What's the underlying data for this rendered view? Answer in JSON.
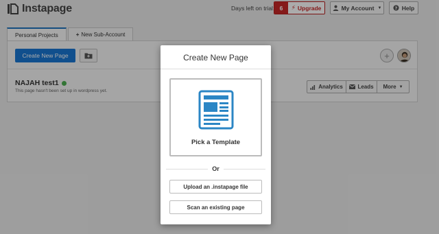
{
  "app": {
    "name": "Instapage"
  },
  "topbar": {
    "trial_label": "Days left on trial:",
    "trial_days": "6",
    "upgrade_label": "Upgrade",
    "account_label": "My Account",
    "help_label": "Help"
  },
  "tabs": [
    {
      "label": "Personal Projects",
      "active": true
    },
    {
      "label": "New Sub-Account",
      "active": false
    }
  ],
  "toolbar": {
    "create_label": "Create New Page"
  },
  "project": {
    "name": "NAJAH test1",
    "note": "This page hasn't been set up in wordpress yet.",
    "status_color": "#4caf50",
    "actions": {
      "analytics": "Analytics",
      "leads": "Leads",
      "more": "More"
    }
  },
  "modal": {
    "title": "Create New Page",
    "template_label": "Pick a Template",
    "or_label": "Or",
    "upload_label": "Upload an .instapage file",
    "scan_label": "Scan an existing page"
  },
  "icons": {
    "logo": "instapage-logo-icon",
    "bolt": "bolt-icon",
    "person": "person-icon",
    "help": "question-icon",
    "folder": "folder-add-icon",
    "add": "plus-circle-icon",
    "template": "document-template-icon",
    "analytics": "bar-chart-icon",
    "leads": "envelope-icon"
  },
  "colors": {
    "primary": "#1976d2",
    "upgrade_red": "#c62828",
    "template_blue": "#2b86c5"
  }
}
